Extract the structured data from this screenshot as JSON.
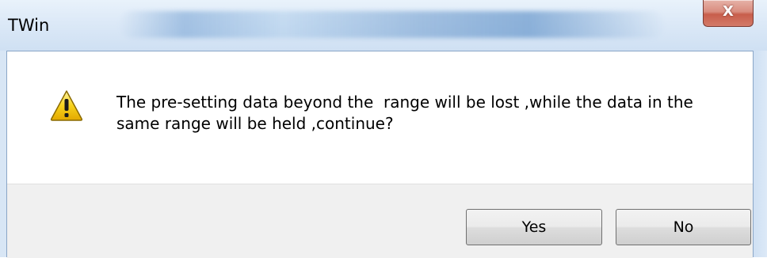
{
  "window": {
    "title": "TWin",
    "close_glyph": "X"
  },
  "dialog": {
    "icon": "warning-icon",
    "message_line1": "The pre-setting data beyond the  range will be lost ,while the data in the",
    "message_line2": "same range will be held ,continue?"
  },
  "buttons": {
    "yes_label": "Yes",
    "no_label": "No"
  },
  "colors": {
    "warning_fill": "#f5c400",
    "warning_outline": "#8a6a00",
    "button_bar": "#f0f0f0",
    "close_button": "#c85e4b"
  }
}
